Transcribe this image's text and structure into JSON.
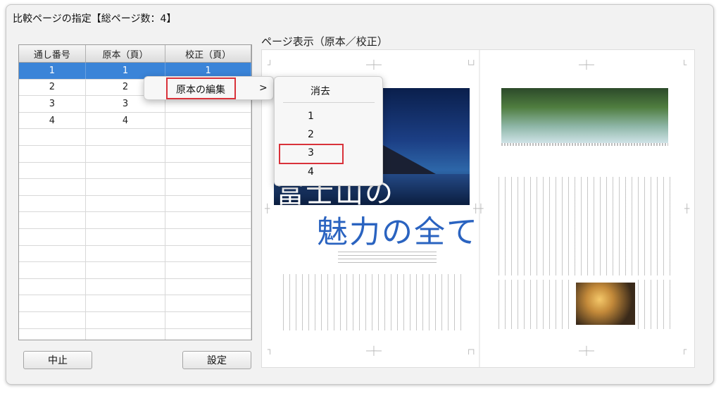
{
  "dialog": {
    "title": "比較ページの指定【総ページ数：4】",
    "preview_label": "ページ表示（原本／校正）"
  },
  "table": {
    "headers": [
      "通し番号",
      "原本（頁）",
      "校正（頁）"
    ],
    "rows": [
      {
        "seq": "1",
        "original": "1",
        "proof": "1",
        "selected": true
      },
      {
        "seq": "2",
        "original": "2",
        "proof": "",
        "selected": false
      },
      {
        "seq": "3",
        "original": "3",
        "proof": "",
        "selected": false
      },
      {
        "seq": "4",
        "original": "4",
        "proof": "",
        "selected": false
      }
    ]
  },
  "buttons": {
    "cancel": "中止",
    "apply": "設定"
  },
  "context_menu": {
    "item_label": "原本の編集",
    "arrow": ">"
  },
  "submenu": {
    "items": [
      "消去",
      "1",
      "2",
      "3",
      "4"
    ],
    "highlighted": "3"
  },
  "preview_page": {
    "title_line1": "富士山の",
    "title_line2": "魅力の全て"
  },
  "colors": {
    "selection": "#3a84d8",
    "highlight_box": "#d9323a",
    "title_blue": "#2a63c0"
  }
}
